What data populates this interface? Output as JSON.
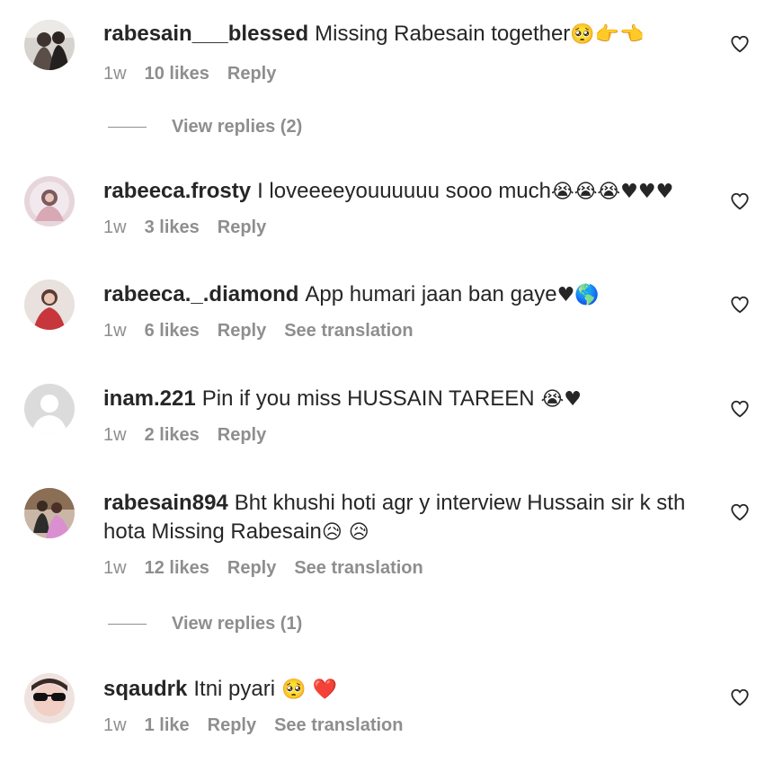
{
  "comments": [
    {
      "username": "rabesain___blessed",
      "text": "Missing Rabesain together",
      "emoji": "🥺👉👈",
      "time": "1w",
      "likes": "10 likes",
      "reply": "Reply",
      "translation": "",
      "view_replies": "View replies (2)"
    },
    {
      "username": "rabeeca.frosty",
      "text": "I loveeeeyouuuuuu sooo much",
      "emoji": "😭😭😭♥♥♥",
      "time": "1w",
      "likes": "3 likes",
      "reply": "Reply",
      "translation": ""
    },
    {
      "username": "rabeeca._.diamond",
      "text": "App humari jaan ban gaye",
      "emoji": "♥🌎",
      "time": "1w",
      "likes": "6 likes",
      "reply": "Reply",
      "translation": "See translation"
    },
    {
      "username": "inam.221",
      "text": "Pin if you miss HUSSAIN TAREEN",
      "emoji": " 😭♥",
      "time": "1w",
      "likes": "2 likes",
      "reply": "Reply",
      "translation": ""
    },
    {
      "username": "rabesain894",
      "text_line1": "Bht khushi hoti agr y interview Hussain sir k sth",
      "text_line2": "hota Missing Rabesain",
      "emoji": "😥 😥",
      "time": "1w",
      "likes": "12 likes",
      "reply": "Reply",
      "translation": "See translation",
      "view_replies": "View replies (1)"
    },
    {
      "username": "sqaudrk",
      "text": "Itni pyari",
      "emoji": " 🥺 ❤️",
      "time": "1w",
      "likes": "1 like",
      "reply": "Reply",
      "translation": "See translation"
    }
  ],
  "icons": {
    "like": "heart-outline-icon"
  },
  "colors": {
    "text": "#262626",
    "meta": "#8e8e8e"
  }
}
